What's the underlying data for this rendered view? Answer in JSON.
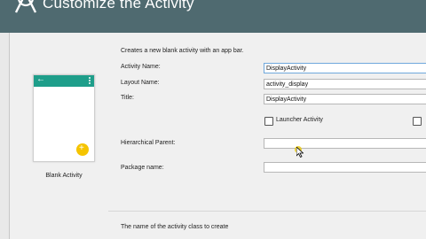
{
  "header": {
    "title": "Customize the Activity"
  },
  "template": {
    "name": "Blank Activity"
  },
  "form": {
    "description": "Creates a new blank activity with an app bar.",
    "activity_name": {
      "label": "Activity Name:",
      "value": "DisplayActivity"
    },
    "layout_name": {
      "label": "Layout Name:",
      "value": "activity_display"
    },
    "title": {
      "label": "Title:",
      "value": "DisplayActivity"
    },
    "launcher": {
      "label": "Launcher Activity",
      "checked": false
    },
    "hierarchical_parent": {
      "label": "Hierarchical Parent:",
      "value": ""
    },
    "package_name": {
      "label": "Package name:",
      "value": ""
    }
  },
  "hint": "The name of the activity class to create",
  "colors": {
    "header": "#4f6a70",
    "appbar": "#1e9e8a",
    "fab": "#f5c400"
  },
  "icons": [
    "android-studio-logo-icon",
    "back-arrow-icon",
    "overflow-menu-icon",
    "fab-add-icon",
    "mouse-pointer-icon"
  ]
}
